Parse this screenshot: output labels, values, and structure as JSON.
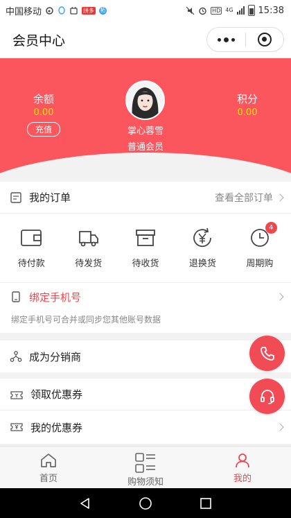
{
  "status_bar": {
    "carrier": "中国移动",
    "sb_badge_1": "拼多",
    "sb_badge_2": "拓",
    "network": "4G",
    "hd": "HD",
    "time": "15:38"
  },
  "nav": {
    "title": "会员中心"
  },
  "profile": {
    "balance_label": "余额",
    "balance_value": "0.00",
    "recharge_label": "充值",
    "points_label": "积分",
    "points_value": "0.00",
    "user_name": "掌心蓉雪",
    "member_level": "普通会员"
  },
  "orders": {
    "title": "我的订单",
    "view_all": "查看全部订单",
    "items": [
      {
        "label": "待付款",
        "icon": "wallet-icon"
      },
      {
        "label": "待发货",
        "icon": "truck-icon"
      },
      {
        "label": "待收货",
        "icon": "package-box-icon"
      },
      {
        "label": "退换货",
        "icon": "yen-return-icon"
      },
      {
        "label": "周期购",
        "icon": "clock-icon",
        "badge": "4"
      }
    ]
  },
  "bind_phone": {
    "title": "绑定手机号",
    "desc": "绑定手机号可合并或同步您其他账号数据"
  },
  "distributor": {
    "title": "成为分销商"
  },
  "coupons": {
    "get_title": "领取优惠券",
    "my_title": "我的优惠券"
  },
  "tabbar": {
    "tabs": [
      {
        "label": "首页",
        "icon": "home-icon"
      },
      {
        "label": "购物须知",
        "icon": "list-grid-icon"
      },
      {
        "label": "我的",
        "icon": "person-icon"
      }
    ],
    "active_index": 2
  },
  "colors": {
    "brand_red": "#fb565d",
    "value_yellow": "#ffe400",
    "phone_red": "#e8474f"
  }
}
